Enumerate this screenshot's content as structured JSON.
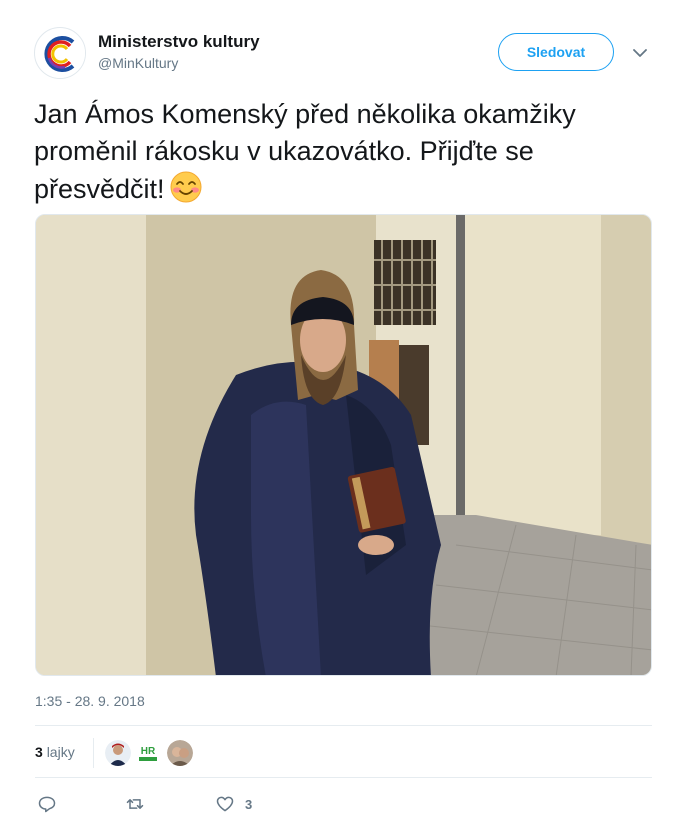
{
  "account": {
    "display_name": "Ministerstvo kultury",
    "handle": "@MinKultury",
    "follow_label": "Sledovat"
  },
  "tweet": {
    "text": "Jan Ámos Komenský před několika okamžiky proměnil rákosku v ukazovátko. Přijďte se přesvědčit!",
    "emoji": "smiling-face-with-smiling-eyes",
    "timestamp": "1:35 - 28. 9. 2018"
  },
  "likes": {
    "count": "3",
    "label": "lajky",
    "liker_badges": [
      "",
      "HR",
      ""
    ]
  },
  "actions": {
    "reply_icon": "reply-icon",
    "retweet_icon": "retweet-icon",
    "like_icon": "heart-icon",
    "like_count": "3"
  },
  "colors": {
    "accent": "#1da1f2",
    "text": "#14171a",
    "muted": "#657786",
    "divider": "#e6ecf0"
  }
}
